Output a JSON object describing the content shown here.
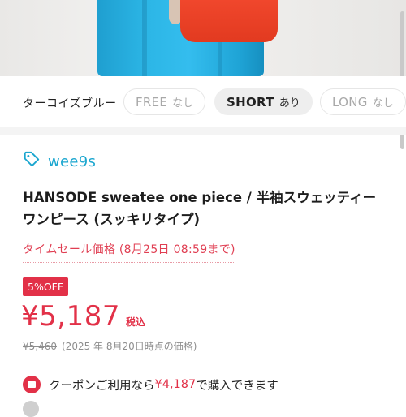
{
  "variant": {
    "color_label": "ターコイズブルー",
    "options": [
      {
        "size": "FREE",
        "stock": "なし",
        "selected": false
      },
      {
        "size": "SHORT",
        "stock": "あり",
        "selected": true
      },
      {
        "size": "LONG",
        "stock": "なし",
        "selected": false
      }
    ]
  },
  "brand": {
    "name": "wee9s",
    "icon": "tag-icon",
    "color": "#1aa6cf"
  },
  "product": {
    "title": "HANSODE sweatee one piece / 半袖スウェッティーワンピース (スッキリタイプ)"
  },
  "sale": {
    "label": "タイムセール価格 (8月25日 08:59まで)",
    "discount": "5%OFF",
    "price": "¥5,187",
    "tax": "税込",
    "original_price": "¥5,460",
    "original_note": "(2025 年 8月20日時点の価格)"
  },
  "coupon": {
    "prefix": "クーポンご利用なら",
    "price": "¥4,187",
    "suffix": "で購入できます",
    "icon": "coupon-icon"
  },
  "colors": {
    "accent": "#e23148",
    "brand": "#1aa6cf"
  }
}
